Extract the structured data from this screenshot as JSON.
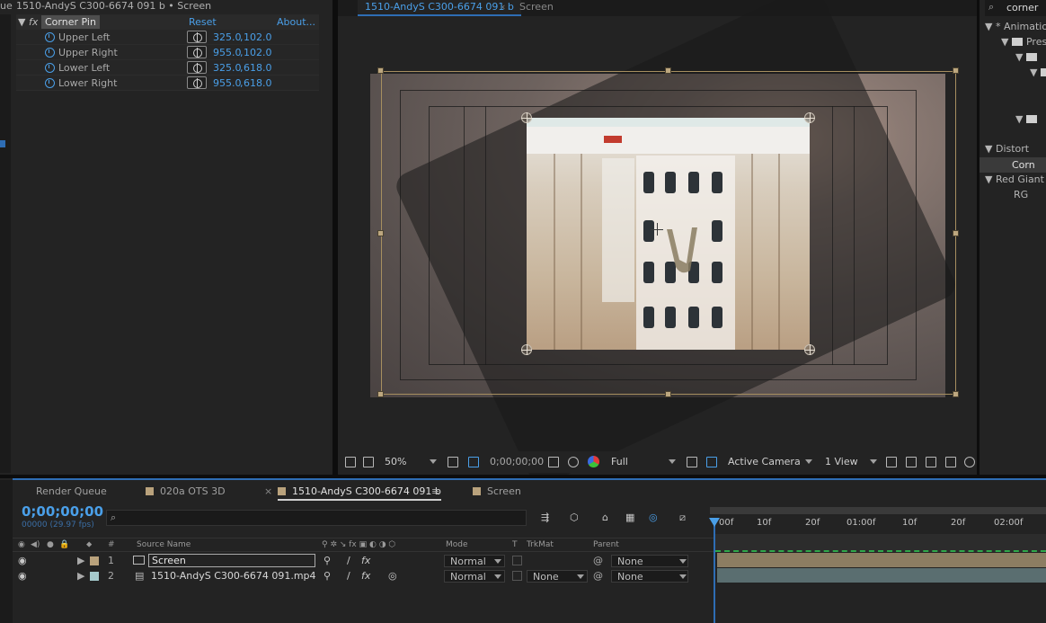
{
  "effect_controls": {
    "breadcrumb": "1510-AndyS C300-6674 091 b • Screen",
    "cut_left_text": "ue",
    "effect": {
      "fx_label": "fx",
      "name": "Corner Pin",
      "reset": "Reset",
      "about": "About..."
    },
    "properties": [
      {
        "name": "Upper Left",
        "x": "325.0",
        "y": "102.0"
      },
      {
        "name": "Upper Right",
        "x": "955.0",
        "y": "102.0"
      },
      {
        "name": "Lower Left",
        "x": "325.0",
        "y": "618.0"
      },
      {
        "name": "Lower Right",
        "x": "955.0",
        "y": "618.0"
      }
    ]
  },
  "viewer": {
    "tab_active": "1510-AndyS C300-6674 091 b",
    "tab_layer": "Screen",
    "toolbar": {
      "zoom": "50%",
      "timecode": "0;00;00;00",
      "resolution": "Full",
      "camera": "Active Camera",
      "views": "1 View"
    }
  },
  "right_panel": {
    "search_value": "corner",
    "items": [
      "* Animation",
      "Pres",
      "",
      "",
      "",
      "",
      "Distort",
      "Corn",
      "Red Giant W",
      "RG"
    ]
  },
  "timeline": {
    "tabs": [
      {
        "label": "Render Queue",
        "swatch": ""
      },
      {
        "label": "020a OTS 3D",
        "swatch": "#b9a27c"
      },
      {
        "label": "1510-AndyS C300-6674 091 b",
        "swatch": "#b9a27c",
        "active": true
      },
      {
        "label": "Screen",
        "swatch": "#b9a27c"
      }
    ],
    "timecode": "0;00;00;00",
    "frame_info": "00000 (29.97 fps)",
    "search_placeholder": "",
    "columns": {
      "number": "#",
      "source_name": "Source Name",
      "mode": "Mode",
      "t": "T",
      "trkmat": "TrkMat",
      "parent": "Parent"
    },
    "layers": [
      {
        "num": "1",
        "name": "Screen",
        "mode": "Normal",
        "trkmat": "",
        "parent": "None",
        "label_color": "#b9a27c"
      },
      {
        "num": "2",
        "name": "1510-AndyS C300-6674 091.mp4",
        "mode": "Normal",
        "trkmat": "None",
        "parent": "None",
        "label_color": "#a5c9cc"
      }
    ],
    "ruler_ticks": [
      "00f",
      "10f",
      "20f",
      "01:00f",
      "10f",
      "20f",
      "02:00f"
    ]
  },
  "colors": {
    "accent_blue": "#4a9fe8",
    "timeline_accent": "#2e6db4",
    "layer1_bar": "#8c7d62",
    "layer2_bar": "#5a6e70"
  }
}
